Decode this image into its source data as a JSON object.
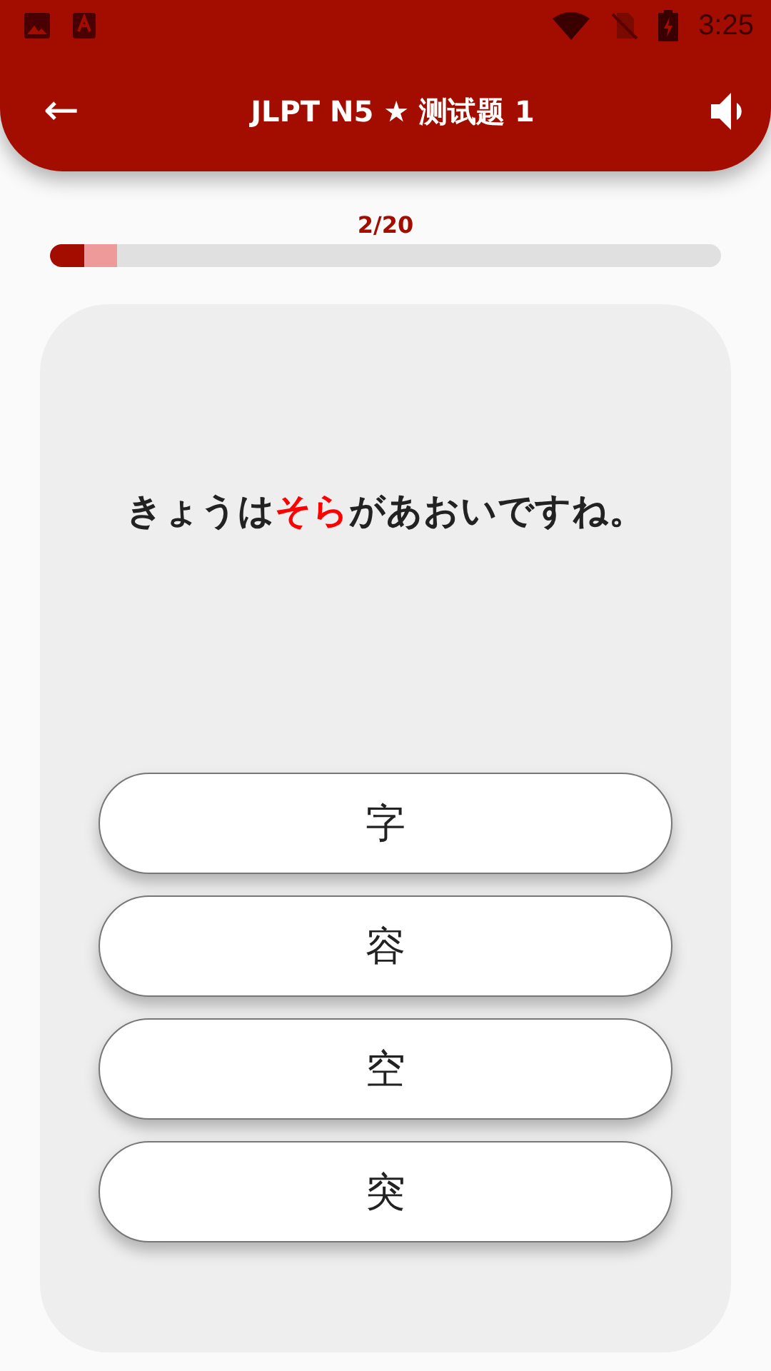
{
  "status_bar": {
    "time": "3:25"
  },
  "app_bar": {
    "back": "←",
    "title": "JLPT N5 ★ 测试题 1"
  },
  "progress": {
    "label": "2/20",
    "bar": {
      "level": 0.05
    },
    "buffer": {
      "level": 0.1
    }
  },
  "question": {
    "parts": [
      {
        "text": "きょうは",
        "highlight": false
      },
      {
        "text": "そら",
        "highlight": true
      },
      {
        "text": "があおいですね。",
        "highlight": false
      }
    ]
  },
  "options": [
    {
      "label": "字"
    },
    {
      "label": "容"
    },
    {
      "label": "空"
    },
    {
      "label": "突"
    }
  ]
}
